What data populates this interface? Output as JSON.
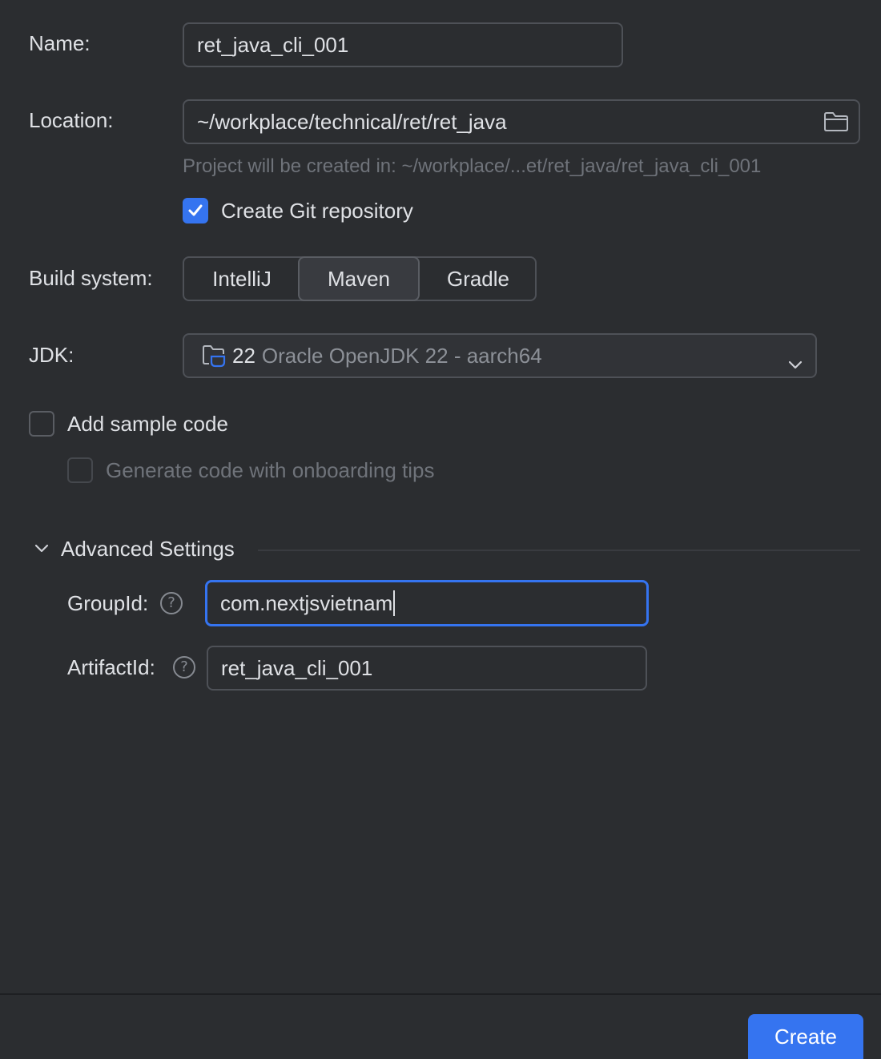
{
  "name": {
    "label": "Name:",
    "value": "ret_java_cli_001"
  },
  "location": {
    "label": "Location:",
    "value": "~/workplace/technical/ret/ret_java",
    "hint": "Project will be created in: ~/workplace/...et/ret_java/ret_java_cli_001",
    "browse_icon": "folder-icon"
  },
  "git": {
    "label": "Create Git repository",
    "checked": true
  },
  "build_system": {
    "label": "Build system:",
    "options": [
      "IntelliJ",
      "Maven",
      "Gradle"
    ],
    "selected": "Maven"
  },
  "jdk": {
    "label": "JDK:",
    "version": "22",
    "name": "Oracle OpenJDK 22 - aarch64",
    "icon": "jdk-folder-icon"
  },
  "sample_code": {
    "label": "Add sample code",
    "checked": false,
    "onboarding_label": "Generate code with onboarding tips",
    "onboarding_checked": false,
    "onboarding_enabled": false
  },
  "advanced": {
    "title": "Advanced Settings",
    "expanded": true,
    "group_id": {
      "label": "GroupId:",
      "value": "com.nextjsvietnam"
    },
    "artifact_id": {
      "label": "ArtifactId:",
      "value": "ret_java_cli_001"
    }
  },
  "footer": {
    "create_label": "Create"
  },
  "colors": {
    "background": "#2b2d30",
    "accent": "#3574f0",
    "text": "#dfe1e5",
    "muted": "#6f737a"
  }
}
